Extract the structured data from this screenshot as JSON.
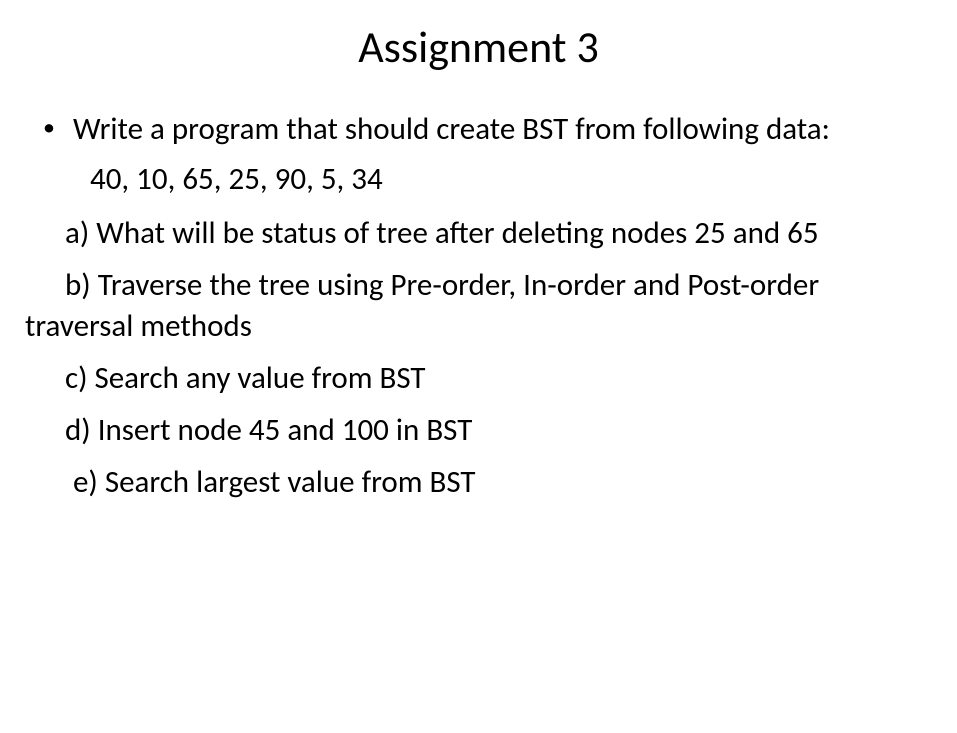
{
  "title": "Assignment 3",
  "main_prompt": "Write a program that should create BST from following data:",
  "data_values": "40, 10, 65, 25, 90, 5, 34",
  "item_a": "a) What will be status of tree after deleting nodes 25 and 65",
  "item_b": "b) Traverse the tree using Pre-order, In-order and Post-order traversal methods",
  "item_c": "c) Search any value from BST",
  "item_d": "d) Insert node 45 and 100 in BST",
  "item_e": "e) Search largest value from BST"
}
